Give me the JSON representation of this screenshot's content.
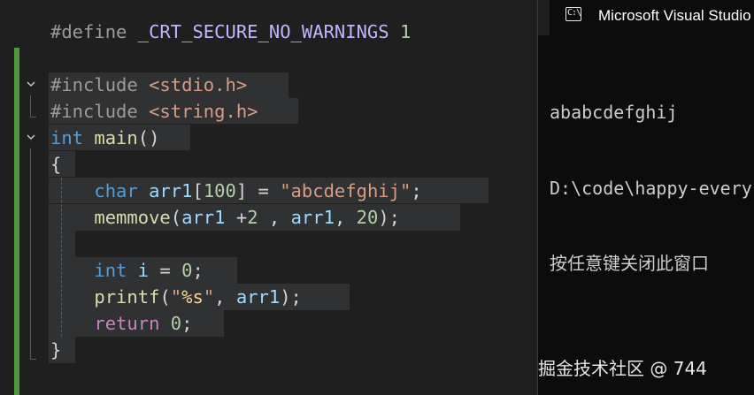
{
  "editor": {
    "lines": [
      {
        "tokens": [
          {
            "t": "#define ",
            "c": "pre"
          },
          {
            "t": "_CRT_SECURE_NO_WARNINGS",
            "c": "macro"
          },
          {
            "t": " ",
            "c": "punct"
          },
          {
            "t": "1",
            "c": "num"
          }
        ]
      },
      {
        "tokens": []
      },
      {
        "tokens": [
          {
            "t": "#include ",
            "c": "pre"
          },
          {
            "t": "<stdio.h>",
            "c": "str2"
          }
        ]
      },
      {
        "tokens": [
          {
            "t": "#include ",
            "c": "pre"
          },
          {
            "t": "<string.h>",
            "c": "str2"
          }
        ]
      },
      {
        "tokens": [
          {
            "t": "int",
            "c": "kw-blue"
          },
          {
            "t": " ",
            "c": "punct"
          },
          {
            "t": "main",
            "c": "fn"
          },
          {
            "t": "()",
            "c": "punct"
          }
        ]
      },
      {
        "tokens": [
          {
            "t": "{",
            "c": "punct"
          }
        ]
      },
      {
        "tokens": [
          {
            "t": "    ",
            "c": "punct"
          },
          {
            "t": "char",
            "c": "kw-blue"
          },
          {
            "t": " ",
            "c": "punct"
          },
          {
            "t": "arr1",
            "c": "var"
          },
          {
            "t": "[",
            "c": "punct"
          },
          {
            "t": "100",
            "c": "num"
          },
          {
            "t": "] = ",
            "c": "punct"
          },
          {
            "t": "\"abcdefghij\"",
            "c": "str2"
          },
          {
            "t": ";",
            "c": "punct"
          }
        ]
      },
      {
        "tokens": [
          {
            "t": "    ",
            "c": "punct"
          },
          {
            "t": "memmove",
            "c": "fn"
          },
          {
            "t": "(",
            "c": "punct"
          },
          {
            "t": "arr1",
            "c": "var"
          },
          {
            "t": " +",
            "c": "punct"
          },
          {
            "t": "2",
            "c": "num"
          },
          {
            "t": " , ",
            "c": "punct"
          },
          {
            "t": "arr1",
            "c": "var"
          },
          {
            "t": ", ",
            "c": "punct"
          },
          {
            "t": "20",
            "c": "num"
          },
          {
            "t": ");",
            "c": "punct"
          }
        ]
      },
      {
        "tokens": []
      },
      {
        "tokens": [
          {
            "t": "    ",
            "c": "punct"
          },
          {
            "t": "int",
            "c": "kw-blue"
          },
          {
            "t": " ",
            "c": "punct"
          },
          {
            "t": "i",
            "c": "var"
          },
          {
            "t": " = ",
            "c": "punct"
          },
          {
            "t": "0",
            "c": "num"
          },
          {
            "t": ";",
            "c": "punct"
          }
        ]
      },
      {
        "tokens": [
          {
            "t": "    ",
            "c": "punct"
          },
          {
            "t": "printf",
            "c": "fn"
          },
          {
            "t": "(",
            "c": "punct"
          },
          {
            "t": "\"",
            "c": "str2"
          },
          {
            "t": "%s",
            "c": "esc"
          },
          {
            "t": "\"",
            "c": "str2"
          },
          {
            "t": ", ",
            "c": "punct"
          },
          {
            "t": "arr1",
            "c": "var"
          },
          {
            "t": ");",
            "c": "punct"
          }
        ]
      },
      {
        "tokens": [
          {
            "t": "    ",
            "c": "punct"
          },
          {
            "t": "return",
            "c": "kw-purple"
          },
          {
            "t": " ",
            "c": "punct"
          },
          {
            "t": "0",
            "c": "num"
          },
          {
            "t": ";",
            "c": "punct"
          }
        ]
      },
      {
        "tokens": [
          {
            "t": "}",
            "c": "punct"
          }
        ]
      }
    ],
    "fold_icon": "chevron-down-icon"
  },
  "console": {
    "icon": "terminal-icon",
    "title": "Microsoft Visual Studio",
    "output": [
      "ababcdefghij",
      "D:\\code\\happy-every",
      "按任意键关闭此窗口"
    ]
  },
  "watermark": "掘金技术社区 @ 744",
  "colors": {
    "editor_bg": "#1f1f1f",
    "change_bar": "#4e9a3a",
    "console_bg": "#0c0c0c"
  }
}
